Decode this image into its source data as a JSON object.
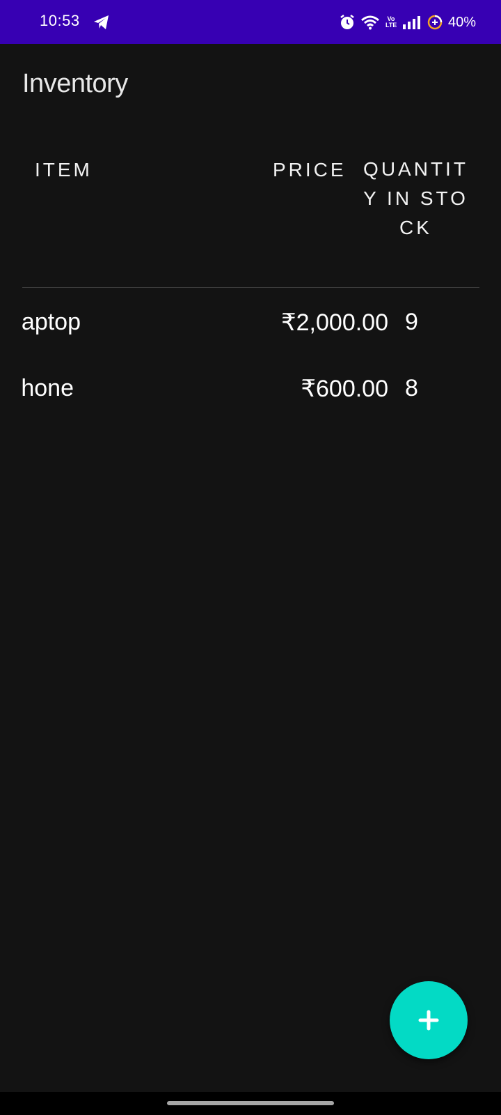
{
  "status_bar": {
    "time": "10:53",
    "network_label": "Vo LTE",
    "battery": "40%",
    "icons": [
      "telegram-icon",
      "alarm-icon",
      "wifi-icon",
      "volte-icon",
      "signal-icon",
      "battery-saver-icon"
    ]
  },
  "app": {
    "title": "Inventory"
  },
  "table": {
    "headers": {
      "item": "ITEM",
      "price": "PRICE",
      "quantity": "QUANTITY IN STOCK"
    },
    "rows": [
      {
        "name": "Laptop",
        "price": "₹2,000.00",
        "quantity": "9"
      },
      {
        "name": "Phone",
        "price": "₹600.00",
        "quantity": "8"
      }
    ]
  },
  "fab": {
    "icon": "plus-icon",
    "color": "#03dac5"
  },
  "colors": {
    "status_bar": "#3700b3",
    "background": "#131313"
  }
}
